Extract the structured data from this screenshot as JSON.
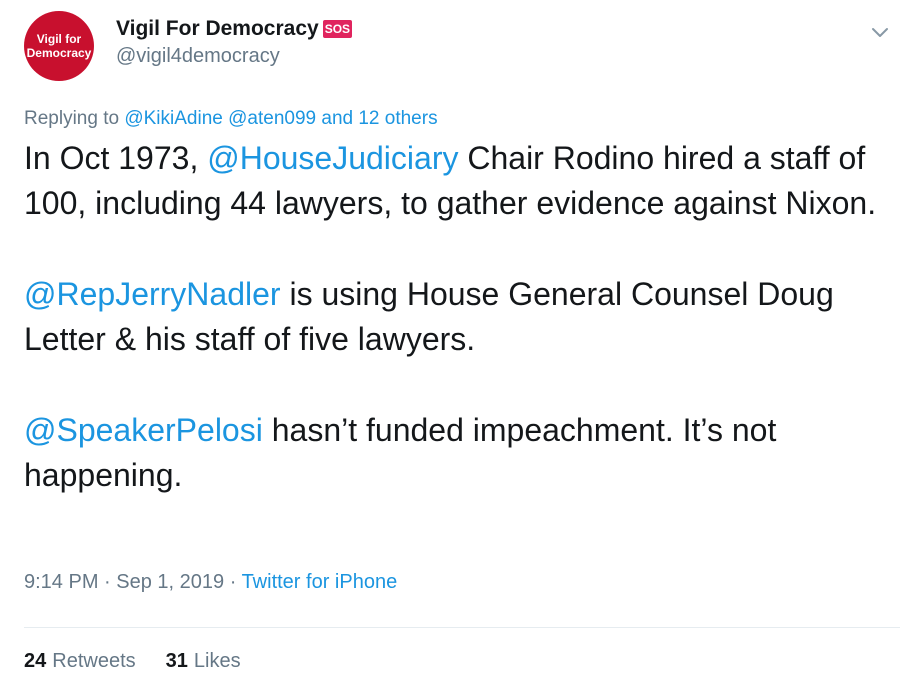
{
  "account": {
    "avatar_text_line1": "Vigil for",
    "avatar_text_line2": "Democracy",
    "display_name": "Vigil For Democracy",
    "badge": "SOS",
    "handle": "@vigil4democracy"
  },
  "replying": {
    "prefix": "Replying to",
    "mention1": "@KikiAdine",
    "mention2": "@aten099",
    "suffix": "and 12 others"
  },
  "tweet": {
    "p1_a": "In Oct 1973, ",
    "p1_mention": "@HouseJudiciary",
    "p1_b": " Chair Rodino hired a staff of 100, including 44 lawyers, to gather evidence against Nixon.",
    "p2_mention": "@RepJerryNadler",
    "p2_b": " is using House General Counsel Doug Letter & his staff of five lawyers.",
    "p3_mention": "@SpeakerPelosi",
    "p3_b": " hasn’t funded impeachment. It’s not happening."
  },
  "meta": {
    "time": "9:14 PM",
    "sep1": " · ",
    "date": "Sep 1, 2019",
    "sep2": " · ",
    "source": "Twitter for iPhone"
  },
  "stats": {
    "retweets_count": "24",
    "retweets_label": "Retweets",
    "likes_count": "31",
    "likes_label": "Likes"
  },
  "colors": {
    "link": "#1b95e0",
    "muted": "#657786",
    "avatar_bg": "#c8102e"
  },
  "icons": {
    "menu": "chevron-down-icon"
  }
}
